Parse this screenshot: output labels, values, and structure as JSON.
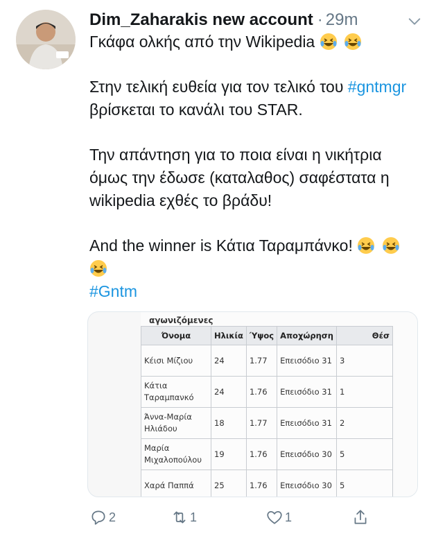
{
  "tweet": {
    "display_name": "Dim_Zaharakis new account",
    "separator": "·",
    "time": "29m",
    "lines": {
      "l1": "Γκάφα ολκής από την Wikipedia",
      "l2a": "Στην τελική ευθεία για τον τελικό του",
      "l2_hashtag": "#gntmgr",
      "l2b": " βρίσκεται το κανάλι του STAR.",
      "l3": "Την απάντηση για το ποια είναι η νικήτρια όμως την έδωσε (καταλαθος) σαφέστατα η wikipedia εχθές το βράδυ!",
      "l4": "And the winner is Κάτια Ταραμπάνκο!",
      "l5_hashtag": "#Gntm"
    }
  },
  "image_card": {
    "caption": "αγωνιζόμενες",
    "headers": [
      "Όνομα",
      "Ηλικία",
      "Ύψος",
      "Αποχώρηση",
      "Θέσ"
    ],
    "rows": [
      [
        "Κέισι Μίζιου",
        "24",
        "1.77",
        "Επεισόδιο 31",
        "3"
      ],
      [
        "Κάτια Ταραμπανκό",
        "24",
        "1.76",
        "Επεισόδιο 31",
        "1"
      ],
      [
        "Άννα-Μαρία Ηλιάδου",
        "18",
        "1.77",
        "Επεισόδιο 31",
        "2"
      ],
      [
        "Μαρία Μιχαλοπούλου",
        "19",
        "1.76",
        "Επεισόδιο 30",
        "5"
      ],
      [
        "Χαρά Παππά",
        "25",
        "1.76",
        "Επεισόδιο 30",
        "5"
      ]
    ]
  },
  "actions": {
    "reply_count": "2",
    "retweet_count": "1",
    "like_count": "1"
  },
  "colors": {
    "link": "#1b95e0",
    "muted": "#657786",
    "text": "#14171a"
  }
}
